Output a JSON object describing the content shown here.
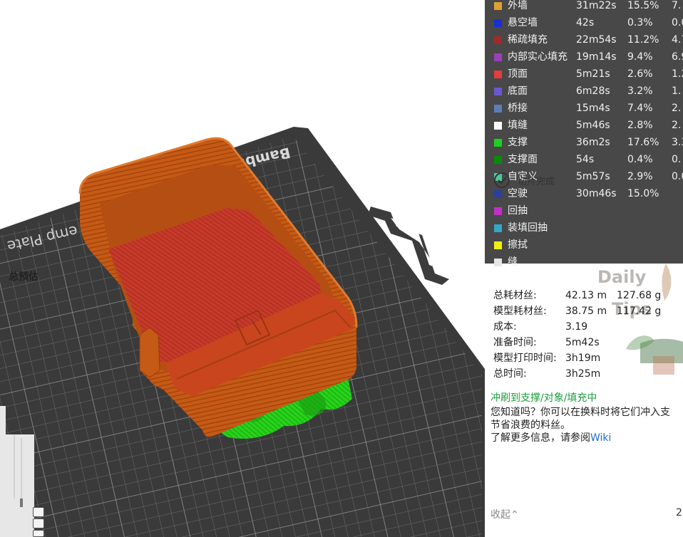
{
  "viewport": {
    "plate_brand": "Bambu",
    "plate_name": "emp Plate"
  },
  "legend": {
    "items": [
      {
        "name": "外墙",
        "time": "31m22s",
        "pct": "15.5%",
        "extra": "7.",
        "color": "#e0a030"
      },
      {
        "name": "悬空墙",
        "time": "42s",
        "pct": "0.3%",
        "extra": "0.0",
        "color": "#1a2fd0"
      },
      {
        "name": "稀疏填充",
        "time": "22m54s",
        "pct": "11.2%",
        "extra": "4.7",
        "color": "#a02a2a"
      },
      {
        "name": "内部实心填充",
        "time": "19m14s",
        "pct": "9.4%",
        "extra": "6.9",
        "color": "#9b40b8"
      },
      {
        "name": "顶面",
        "time": "5m21s",
        "pct": "2.6%",
        "extra": "1.2",
        "color": "#e63c3c"
      },
      {
        "name": "底面",
        "time": "6m28s",
        "pct": "3.2%",
        "extra": "1.",
        "color": "#6a58d0"
      },
      {
        "name": "桥接",
        "time": "15m4s",
        "pct": "7.4%",
        "extra": "2.",
        "color": "#5a7fb8"
      },
      {
        "name": "填缝",
        "time": "5m46s",
        "pct": "2.8%",
        "extra": "2.",
        "color": "#ffffff"
      },
      {
        "name": "支撑",
        "time": "36m2s",
        "pct": "17.6%",
        "extra": "3.3",
        "color": "#1ed01e"
      },
      {
        "name": "支撑面",
        "time": "54s",
        "pct": "0.4%",
        "extra": "0.",
        "color": "#0a8a0a"
      },
      {
        "name": "自定义",
        "time": "5m57s",
        "pct": "2.9%",
        "extra": "0.0",
        "color": "#4fc79a"
      },
      {
        "name": "空驶",
        "time": "30m46s",
        "pct": "15.0%",
        "extra": "",
        "color": "#2a3fa0"
      },
      {
        "name": "回抽",
        "time": "",
        "pct": "",
        "extra": "",
        "color": "#c030c8"
      },
      {
        "name": "装填回抽",
        "time": "",
        "pct": "",
        "extra": "",
        "color": "#33a6c9"
      },
      {
        "name": "擦拭",
        "time": "",
        "pct": "",
        "extra": "",
        "color": "#f2ef10"
      },
      {
        "name": "缝",
        "time": "",
        "pct": "",
        "extra": "",
        "color": "#e6e6e6"
      }
    ]
  },
  "slice_status": {
    "label": "切片完成"
  },
  "estimate": {
    "title": "总预估",
    "rows": [
      {
        "label": "总耗材丝:",
        "v1": "42.13 m",
        "v2": "127.68 g"
      },
      {
        "label": "模型耗材丝:",
        "v1": "38.75 m",
        "v2": "117.42 g"
      },
      {
        "label": "成本:",
        "v1": "3.19",
        "v2": ""
      },
      {
        "label": "准备时间:",
        "v1": "5m42s",
        "v2": ""
      },
      {
        "label": "模型打印时间:",
        "v1": "3h19m",
        "v2": ""
      },
      {
        "label": "总时间:",
        "v1": "3h25m",
        "v2": ""
      }
    ]
  },
  "daily_tips": {
    "word1": "Daily",
    "word2": "Tips"
  },
  "tip": {
    "title": "冲刷到支撑/对象/填充中",
    "line1": "您知道吗？你可以在换料时将它们冲入支",
    "line2": "节省浪费的料丝。",
    "line3_prefix": "了解更多信息，请参阅",
    "link": "Wiki",
    "collapse": "收起⌃",
    "page": "2"
  }
}
